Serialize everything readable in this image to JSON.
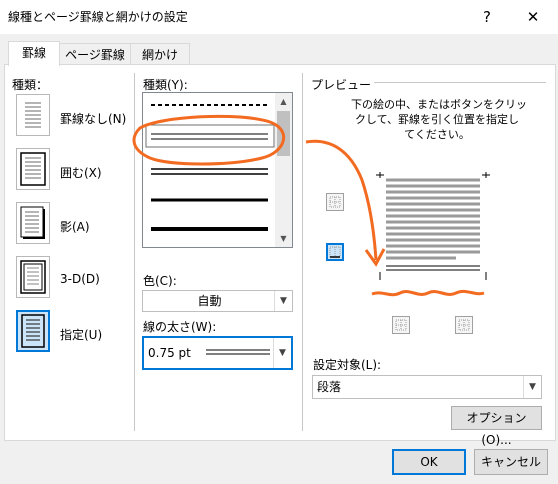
{
  "window": {
    "title": "線種とページ罫線と網かけの設定",
    "help_label": "?",
    "close_label": "✕"
  },
  "tabs": [
    "罫線",
    "ページ罫線",
    "網かけ"
  ],
  "settings": {
    "heading": "種類：",
    "items": [
      "罫線なし(N)",
      "囲む(X)",
      "影(A)",
      "3-D(D)",
      "指定(U)"
    ]
  },
  "style": {
    "label": "種類(Y):",
    "color_label": "色(C):",
    "color_value": "自動",
    "width_label": "線の太さ(W):",
    "width_value": "0.75 pt",
    "scroll_up": "▲",
    "scroll_down": "▼"
  },
  "preview": {
    "heading": "プレビュー",
    "instruction": [
      "下の絵の中、またはボタンをクリッ",
      "クして、罫線を引く位置を指定し",
      "てください。"
    ],
    "apply_label": "設定対象(L):",
    "apply_value": "段落",
    "options_label": "オプション(O)..."
  },
  "footer": {
    "ok_label": "OK",
    "cancel_label": "キャンセル"
  },
  "colors": {
    "accent": "#0078d7",
    "annotation": "#f26b21"
  }
}
